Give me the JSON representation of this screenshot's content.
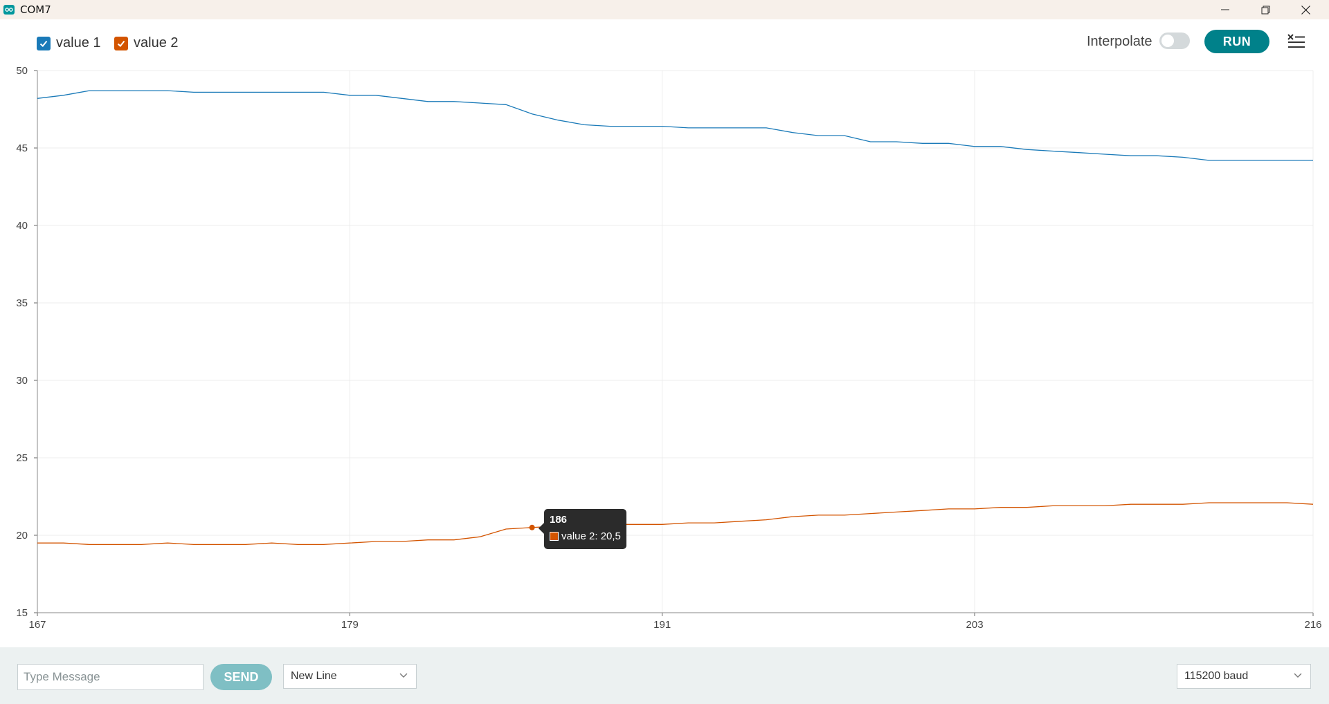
{
  "window": {
    "title": "COM7"
  },
  "legend": [
    {
      "label": "value 1",
      "color": "#1a7ab8",
      "checked": true
    },
    {
      "label": "value 2",
      "color": "#d35400",
      "checked": true
    }
  ],
  "toolbar": {
    "interpolate_label": "Interpolate",
    "interpolate_on": false,
    "run_label": "RUN"
  },
  "chart_data": {
    "type": "line",
    "xlim": [
      167,
      216
    ],
    "ylim": [
      15,
      50
    ],
    "xticks": [
      167,
      179,
      191,
      203,
      216
    ],
    "yticks": [
      15,
      20,
      25,
      30,
      35,
      40,
      45,
      50
    ],
    "grid": true,
    "series": [
      {
        "name": "value 1",
        "color": "#1a7ab8",
        "x": [
          167,
          168,
          169,
          170,
          171,
          172,
          173,
          174,
          175,
          176,
          177,
          178,
          179,
          180,
          181,
          182,
          183,
          184,
          185,
          186,
          187,
          188,
          189,
          190,
          191,
          192,
          193,
          194,
          195,
          196,
          197,
          198,
          199,
          200,
          201,
          202,
          203,
          204,
          205,
          206,
          207,
          208,
          209,
          210,
          211,
          212,
          213,
          214,
          215,
          216
        ],
        "y": [
          48.2,
          48.4,
          48.7,
          48.7,
          48.7,
          48.7,
          48.6,
          48.6,
          48.6,
          48.6,
          48.6,
          48.6,
          48.4,
          48.4,
          48.2,
          48.0,
          48.0,
          47.9,
          47.8,
          47.2,
          46.8,
          46.5,
          46.4,
          46.4,
          46.4,
          46.3,
          46.3,
          46.3,
          46.3,
          46.0,
          45.8,
          45.8,
          45.4,
          45.4,
          45.3,
          45.3,
          45.1,
          45.1,
          44.9,
          44.8,
          44.7,
          44.6,
          44.5,
          44.5,
          44.4,
          44.2,
          44.2,
          44.2,
          44.2,
          44.2
        ]
      },
      {
        "name": "value 2",
        "color": "#d35400",
        "x": [
          167,
          168,
          169,
          170,
          171,
          172,
          173,
          174,
          175,
          176,
          177,
          178,
          179,
          180,
          181,
          182,
          183,
          184,
          185,
          186,
          187,
          188,
          189,
          190,
          191,
          192,
          193,
          194,
          195,
          196,
          197,
          198,
          199,
          200,
          201,
          202,
          203,
          204,
          205,
          206,
          207,
          208,
          209,
          210,
          211,
          212,
          213,
          214,
          215,
          216
        ],
        "y": [
          19.5,
          19.5,
          19.4,
          19.4,
          19.4,
          19.5,
          19.4,
          19.4,
          19.4,
          19.5,
          19.4,
          19.4,
          19.5,
          19.6,
          19.6,
          19.7,
          19.7,
          19.9,
          20.4,
          20.5,
          20.6,
          20.6,
          20.7,
          20.7,
          20.7,
          20.8,
          20.8,
          20.9,
          21.0,
          21.2,
          21.3,
          21.3,
          21.4,
          21.5,
          21.6,
          21.7,
          21.7,
          21.8,
          21.8,
          21.9,
          21.9,
          21.9,
          22.0,
          22.0,
          22.0,
          22.1,
          22.1,
          22.1,
          22.1,
          22.0
        ]
      }
    ],
    "tooltip": {
      "x": 186,
      "title": "186",
      "series": "value 2",
      "text": "value 2: 20,5",
      "value": 20.5
    }
  },
  "footer": {
    "message_placeholder": "Type Message",
    "send_label": "SEND",
    "line_ending": "New Line",
    "baud": "115200 baud"
  }
}
